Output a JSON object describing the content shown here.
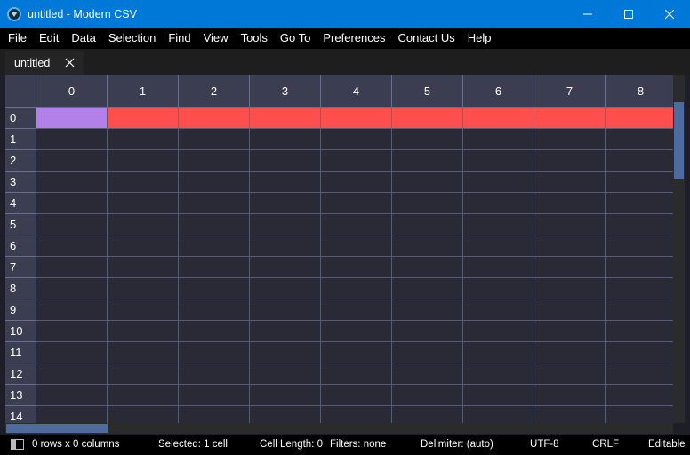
{
  "window": {
    "title": "untitled - Modern CSV",
    "app_icon": "modern-csv-logo-icon",
    "controls": [
      "minimize-icon",
      "maximize-icon",
      "close-icon"
    ]
  },
  "menu": [
    "File",
    "Edit",
    "Data",
    "Selection",
    "Find",
    "View",
    "Tools",
    "Go To",
    "Preferences",
    "Contact Us",
    "Help"
  ],
  "tabs": [
    {
      "label": "untitled",
      "close_icon": "close-icon"
    }
  ],
  "grid": {
    "column_headers": [
      "0",
      "1",
      "2",
      "3",
      "4",
      "5",
      "6",
      "7",
      "8"
    ],
    "row_headers": [
      "0",
      "1",
      "2",
      "3",
      "4",
      "5",
      "6",
      "7",
      "8",
      "9",
      "10",
      "11",
      "12",
      "13",
      "14"
    ],
    "selected_cell": {
      "row": 0,
      "col": 0,
      "color": "#b180e8"
    },
    "highlighted_row": {
      "row": 0,
      "color": "#ff4e4e"
    }
  },
  "status": {
    "panel_icon": "panel-toggle-icon",
    "dimensions": "0 rows x 0 columns",
    "selected": "Selected: 1 cell",
    "cell_length": "Cell Length: 0",
    "filters": "Filters: none",
    "delimiter": "Delimiter: (auto)",
    "encoding": "UTF-8",
    "line_ending": "CRLF",
    "mode": "Editable"
  },
  "colors": {
    "titlebar": "#0078d7",
    "grid_bg": "#2a2a36",
    "header_bg": "#3b3e50",
    "scrollbar_thumb": "#4d6b9f"
  }
}
